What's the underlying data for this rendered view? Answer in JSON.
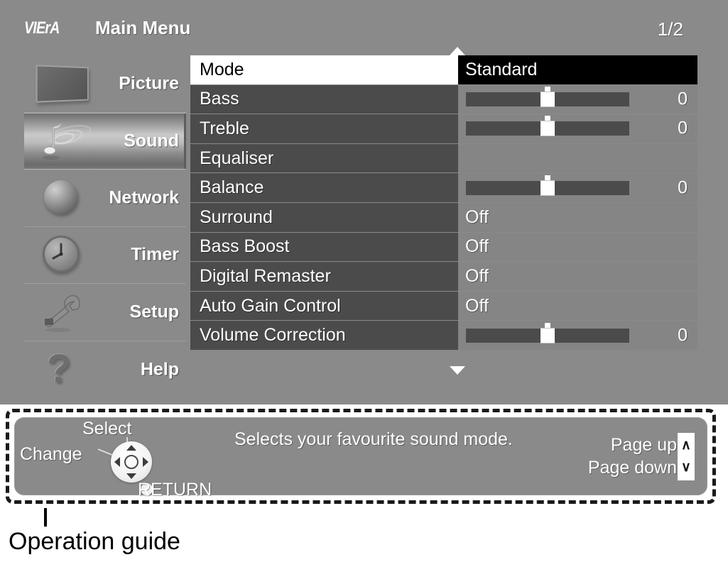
{
  "header": {
    "brand": "VIErA",
    "title": "Main Menu",
    "page_indicator": "1/2"
  },
  "sidebar": {
    "items": [
      {
        "label": "Picture",
        "icon": "tv-icon",
        "selected": false
      },
      {
        "label": "Sound",
        "icon": "music-note-icon",
        "selected": true
      },
      {
        "label": "Network",
        "icon": "globe-icon",
        "selected": false
      },
      {
        "label": "Timer",
        "icon": "clock-icon",
        "selected": false
      },
      {
        "label": "Setup",
        "icon": "wrench-icon",
        "selected": false
      },
      {
        "label": "Help",
        "icon": "question-mark-icon",
        "selected": false
      }
    ]
  },
  "settings": {
    "scroll_up_icon": "triangle-up-icon",
    "scroll_down_icon": "triangle-down-icon",
    "rows": [
      {
        "label": "Mode",
        "value": "Standard",
        "type": "text",
        "selected": true
      },
      {
        "label": "Bass",
        "value": "0",
        "type": "slider",
        "selected": false
      },
      {
        "label": "Treble",
        "value": "0",
        "type": "slider",
        "selected": false
      },
      {
        "label": "Equaliser",
        "value": "",
        "type": "empty",
        "selected": false
      },
      {
        "label": "Balance",
        "value": "0",
        "type": "slider",
        "selected": false
      },
      {
        "label": "Surround",
        "value": "Off",
        "type": "text",
        "selected": false
      },
      {
        "label": "Bass Boost",
        "value": "Off",
        "type": "text",
        "selected": false
      },
      {
        "label": "Digital Remaster",
        "value": "Off",
        "type": "text",
        "selected": false
      },
      {
        "label": "Auto Gain Control",
        "value": "Off",
        "type": "text",
        "selected": false
      },
      {
        "label": "Volume Correction",
        "value": "0",
        "type": "slider",
        "selected": false
      }
    ]
  },
  "guide": {
    "select_label": "Select",
    "change_label": "Change",
    "return_label": "RETURN",
    "description": "Selects your favourite sound mode.",
    "page_up_label": "Page up",
    "page_down_label": "Page down",
    "page_up_key": "∧",
    "page_down_key": "∨"
  },
  "caption": {
    "text": "Operation guide"
  },
  "colors": {
    "screen_bg": "#8a8a8a",
    "row_label_bg": "#4b4b4b",
    "row_value_bg": "#858585",
    "selected_label_bg": "#ffffff",
    "selected_value_bg": "#000000",
    "text": "#ffffff"
  }
}
